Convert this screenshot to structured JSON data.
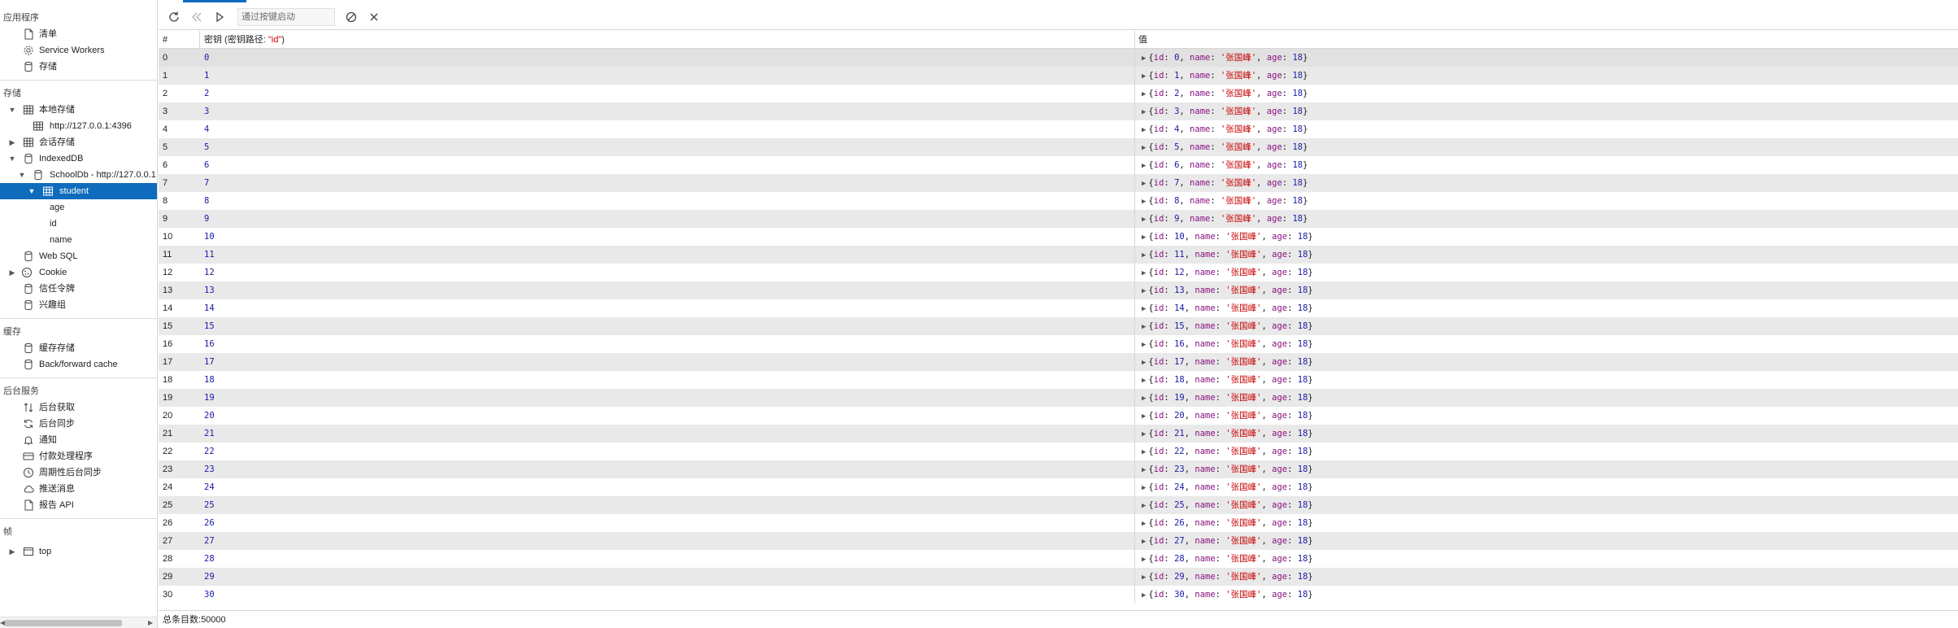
{
  "sidebar": {
    "app_section": {
      "title": "应用程序",
      "items": [
        {
          "label": "清单",
          "icon": "file-icon"
        },
        {
          "label": "Service Workers",
          "icon": "gear-icon"
        },
        {
          "label": "存储",
          "icon": "database-icon"
        }
      ]
    },
    "storage_section": {
      "title": "存储",
      "local_storage": "本地存储",
      "local_storage_origin": "http://127.0.0.1:4396",
      "session_storage": "会话存储",
      "indexeddb": "IndexedDB",
      "db_name": "SchoolDb - http://127.0.0.1",
      "store_name": "student",
      "indexes": [
        "age",
        "id",
        "name"
      ],
      "web_sql": "Web SQL",
      "cookie": "Cookie",
      "trust_tokens": "信任令牌",
      "interest_groups": "兴趣组"
    },
    "cache_section": {
      "title": "缓存",
      "items": [
        {
          "label": "缓存存储",
          "icon": "database-icon"
        },
        {
          "label": "Back/forward cache",
          "icon": "database-icon"
        }
      ]
    },
    "background_section": {
      "title": "后台服务",
      "items": [
        {
          "label": "后台获取",
          "icon": "arrows-updown-icon"
        },
        {
          "label": "后台同步",
          "icon": "sync-icon"
        },
        {
          "label": "通知",
          "icon": "bell-icon"
        },
        {
          "label": "付款处理程序",
          "icon": "card-icon"
        },
        {
          "label": "周期性后台同步",
          "icon": "clock-icon"
        },
        {
          "label": "推送消息",
          "icon": "cloud-icon"
        },
        {
          "label": "报告 API",
          "icon": "file-icon"
        }
      ]
    },
    "frames_section": {
      "title": "帧",
      "top_frame": "top"
    }
  },
  "toolbar": {
    "filter_placeholder": "通过按键启动"
  },
  "grid": {
    "col_index": "#",
    "col_key_prefix": "密钥 (密钥路径: ",
    "col_key_path": "\"id\"",
    "col_key_suffix": ")",
    "col_value": "值",
    "value_name": "张国峰",
    "value_age": "18",
    "rows": [
      "0",
      "1",
      "2",
      "3",
      "4",
      "5",
      "6",
      "7",
      "8",
      "9",
      "10",
      "11",
      "12",
      "13",
      "14",
      "15",
      "16",
      "17",
      "18",
      "19",
      "20",
      "21",
      "22",
      "23",
      "24",
      "25",
      "26",
      "27",
      "28",
      "29",
      "30"
    ]
  },
  "status": {
    "total_label": "总条目数:",
    "total_value": "50000"
  },
  "colors": {
    "selection": "#0f6cbd",
    "string": "#c80000",
    "number": "#1a1aa6",
    "property": "#881280"
  }
}
